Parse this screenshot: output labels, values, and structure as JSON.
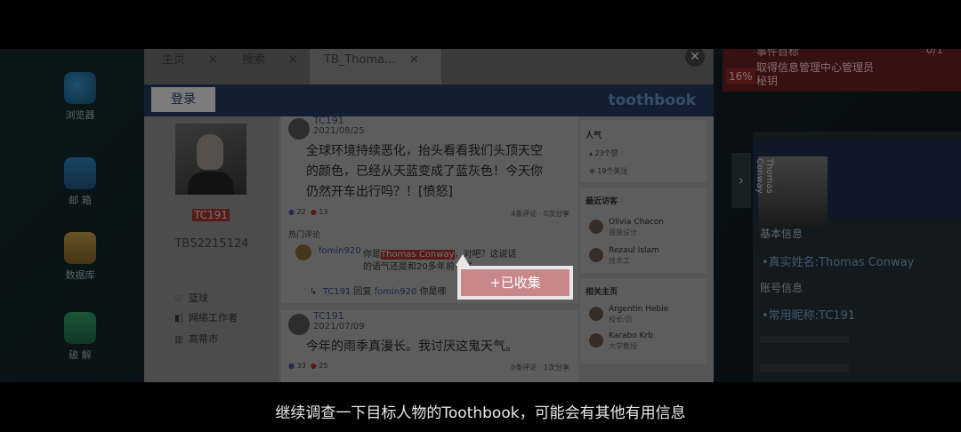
{
  "subtitle": "继续调查一下目标人物的Toothbook，可能会有其他有用信息",
  "desktop": {
    "icons": [
      {
        "label": "浏览器",
        "icon": "browser-icon"
      },
      {
        "label": "邮 箱",
        "icon": "mail-icon"
      },
      {
        "label": "数据库",
        "icon": "database-icon"
      },
      {
        "label": "破 解",
        "icon": "shield-icon"
      }
    ]
  },
  "task": {
    "title": "事件目标",
    "count": "0/1",
    "percent": "16%",
    "description_line1": "取得信息管理中心管理员",
    "description_line2": "秘钥"
  },
  "browser": {
    "tabs": [
      {
        "label": "主页"
      },
      {
        "label": "搜索"
      },
      {
        "label": "TB_Thoma..."
      }
    ],
    "close_label": "✕",
    "login_label": "登录",
    "brand": "toothbook"
  },
  "profile": {
    "name": "TC191",
    "id": "TB52215124",
    "info": [
      {
        "icon": "heart-icon",
        "text": "篮球"
      },
      {
        "icon": "briefcase-icon",
        "text": "网络工作者"
      },
      {
        "icon": "building-icon",
        "text": "高蒂市"
      }
    ]
  },
  "posts": [
    {
      "user": "TC191",
      "date": "2021/08/25",
      "text_line1": "全球环境持续恶化，抬头看看我们头顶天空",
      "text_line2": "的颜色，已经从天蓝变成了蓝灰色！今天你",
      "text_line3": "仍然开车出行吗？！[愤怒]",
      "likes": "22",
      "dislikes": "13",
      "comments": "4条评论",
      "shares": "0次分享",
      "hot_label": "热门评论",
      "comment1_user": "fomin920",
      "comment1_pre": "你是",
      "comment1_highlight": "Thomas Conway",
      "comment1_post": "，对吧？这说话",
      "comment1_line2": "的语气还是和20多年前一样",
      "reply_user": "TC191",
      "reply_verb": "回复",
      "reply_target": "fomin920",
      "reply_text": "你是哪"
    },
    {
      "user": "TC191",
      "date": "2021/07/09",
      "text_line1": "今年的雨季真漫长。我讨厌这鬼天气。",
      "likes": "33",
      "dislikes": "25",
      "comments": "0条评论",
      "shares": "1次分享"
    }
  ],
  "sidebar": {
    "popularity_title": "人气",
    "likes_text": "23个赞",
    "follows_text": "19个关注",
    "visitors_title": "最近访客",
    "visitors": [
      {
        "name": "Olivia Chacon",
        "role": "服装设计"
      },
      {
        "name": "Rezaul Islam",
        "role": "技术工"
      }
    ],
    "related_title": "相关主页",
    "related": [
      {
        "name": "Argentin Hebie",
        "role": "校长/员"
      },
      {
        "name": "Karabo Krb",
        "role": "大学教授"
      }
    ]
  },
  "toast": {
    "label": "+已收集"
  },
  "details": {
    "section1": "基本信息",
    "real_name": "•真实姓名:Thomas Conway",
    "section2": "账号信息",
    "nickname": "•常用昵称:TC191",
    "vertical_name": "Thomas Conway"
  }
}
